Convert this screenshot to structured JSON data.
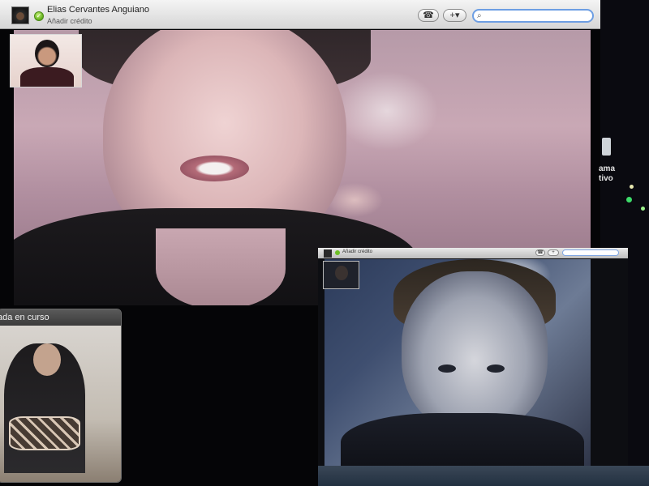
{
  "main_window": {
    "contact_name": "Elias Cervantes Anguiano",
    "contact_subtitle": "Añadir crédito",
    "status_glyph": "✓",
    "dialpad_icon": "☎",
    "add_button_label": "+▾",
    "search": {
      "value": "",
      "placeholder": "",
      "icon": "⌕"
    }
  },
  "background": {
    "text_line_1": "ama",
    "text_line_2": "tivo",
    "dot_colors": [
      "#3ddc6a",
      "#e8e8b0",
      "#9cf08a"
    ]
  },
  "call_in_progress_window": {
    "title": "ada en curso"
  },
  "second_window": {
    "contact_subtitle": "Añadir crédito",
    "dialpad_icon": "☎",
    "add_button_label": "+"
  },
  "colors": {
    "status_green": "#5fae1a",
    "search_focus_blue": "#6d9ee3"
  }
}
